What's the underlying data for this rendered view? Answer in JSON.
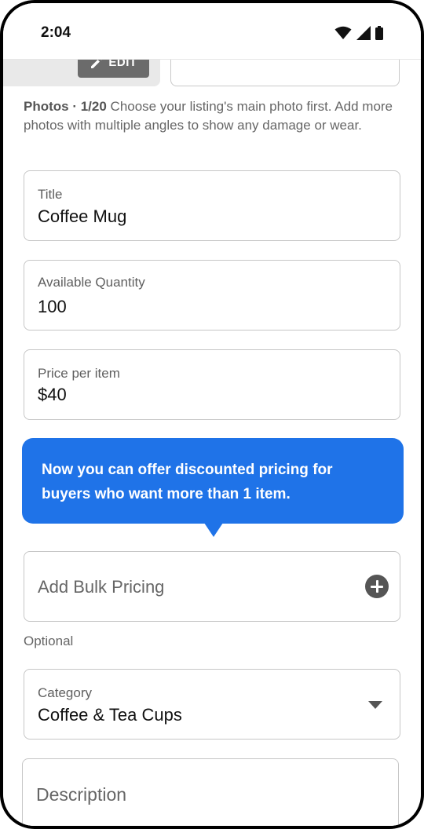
{
  "status_bar": {
    "time": "2:04"
  },
  "photos": {
    "edit_label": "EDIT",
    "count_label": "Photos · 1/20",
    "hint": " Choose your listing's main photo first. Add more photos with multiple angles to show any damage or wear."
  },
  "form": {
    "title": {
      "label": "Title",
      "value": "Coffee Mug"
    },
    "quantity": {
      "label": "Available Quantity",
      "value": "100"
    },
    "price": {
      "label": "Price per item",
      "value": "$40"
    },
    "tooltip": {
      "text": "Now you can offer discounted pricing for buyers who want more than 1 item."
    },
    "bulk_pricing": {
      "label": "Add Bulk Pricing",
      "helper": "Optional"
    },
    "category": {
      "label": "Category",
      "value": "Coffee & Tea Cups"
    },
    "description": {
      "placeholder": "Description"
    }
  },
  "colors": {
    "accent": "#1f73e8",
    "edit_button": "#6b6b6b"
  }
}
